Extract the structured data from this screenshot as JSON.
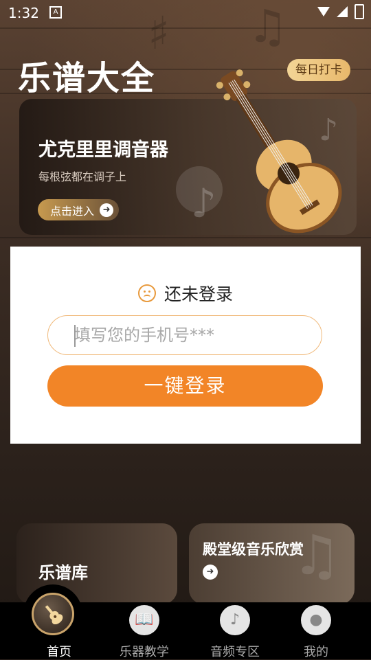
{
  "status_bar": {
    "time": "1:32",
    "notification_icon": "a-notification-icon",
    "wifi_icon": "wifi-icon",
    "signal_icon": "signal-icon",
    "battery_icon": "battery-icon"
  },
  "header": {
    "title": "乐谱大全",
    "checkin_label": "每日打卡"
  },
  "banner": {
    "title": "尤克里里调音器",
    "subtitle": "每根弦都在调子上",
    "enter_label": "点击进入",
    "enter_icon": "arrow-right-icon",
    "image_icon": "ukulele-icon"
  },
  "login": {
    "status_text": "还未登录",
    "status_icon": "sad-face-icon",
    "phone_placeholder": "填写您的手机号***",
    "phone_value": "",
    "login_button_label": "一键登录"
  },
  "cards": {
    "library_title": "乐谱库",
    "music_title": "殿堂级音乐欣赏",
    "music_icon": "arrow-right-icon"
  },
  "tabbar": {
    "items": [
      {
        "label": "首页",
        "icon": "guitar-icon",
        "active": true
      },
      {
        "label": "乐器教学",
        "icon": "book-icon",
        "active": false
      },
      {
        "label": "音频专区",
        "icon": "music-note-icon",
        "active": false
      },
      {
        "label": "我的",
        "icon": "user-icon",
        "active": false
      }
    ]
  },
  "colors": {
    "accent_orange": "#f28527",
    "input_border": "#f0b97a",
    "checkin_gold": "#e8b86b"
  }
}
